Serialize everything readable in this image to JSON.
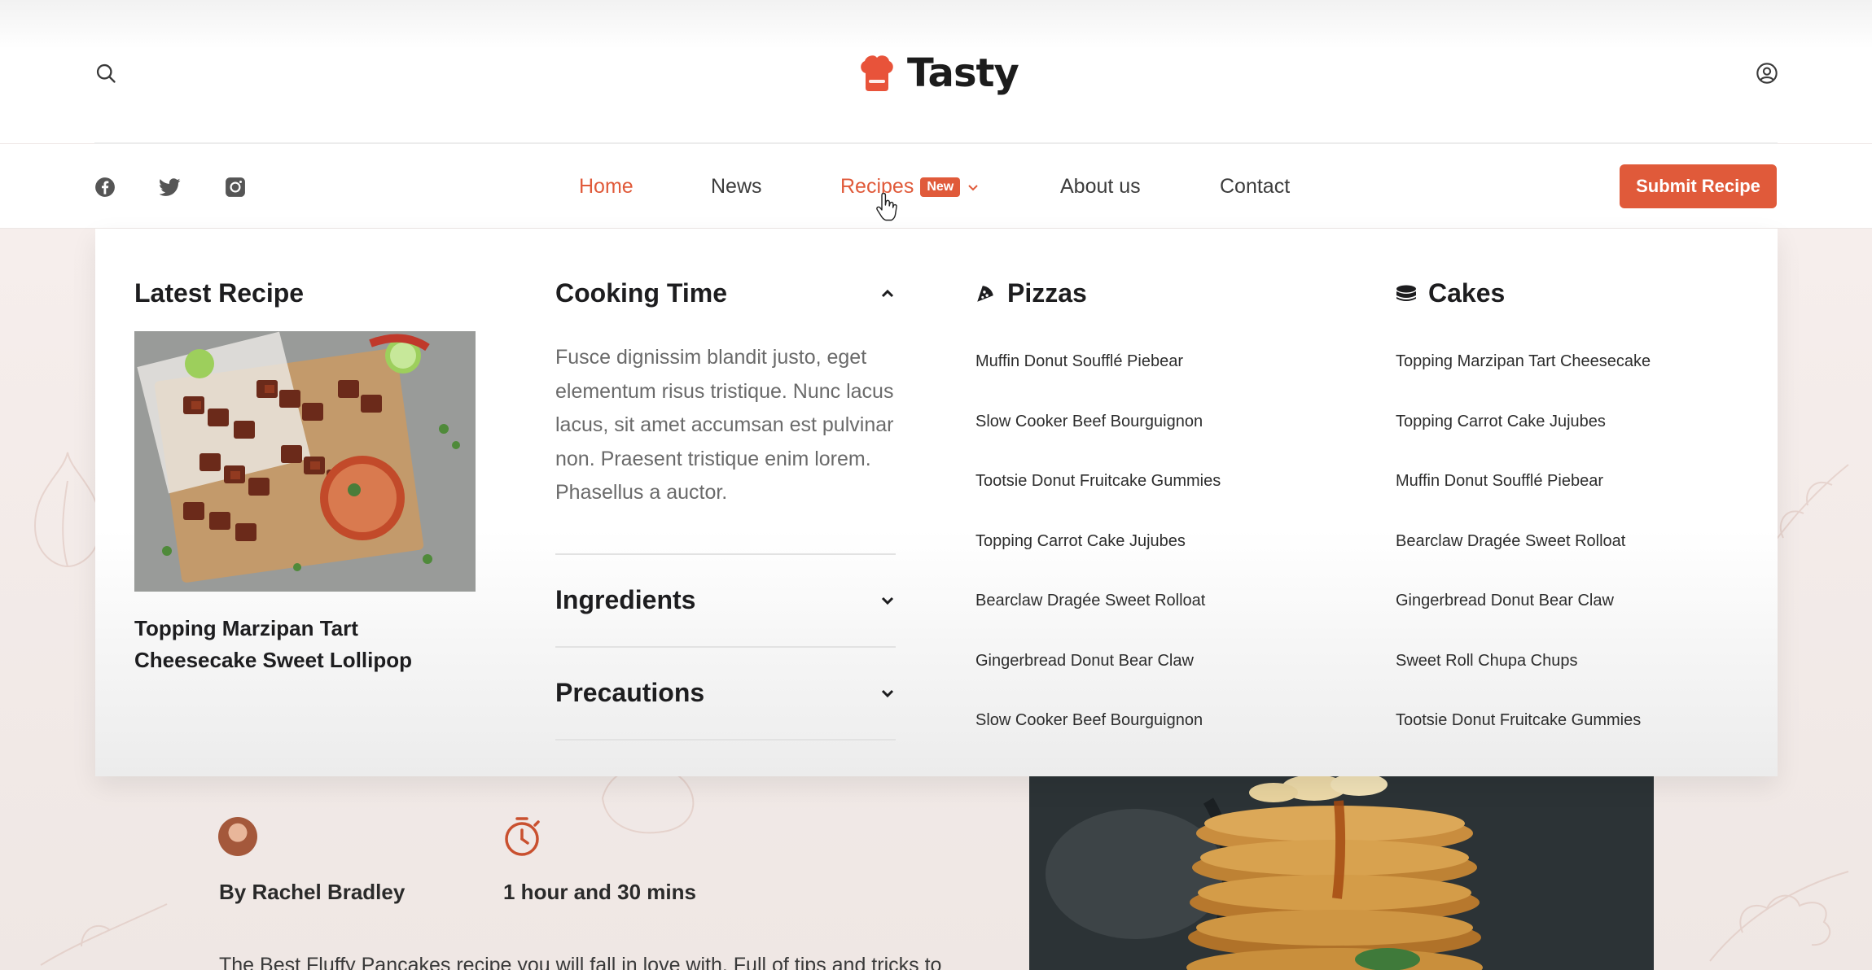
{
  "brand": {
    "name": "Tasty",
    "accent": "#e05a3a"
  },
  "header": {
    "search_icon": "search-icon",
    "user_icon": "user-circle-icon"
  },
  "social": [
    "facebook-icon",
    "twitter-icon",
    "instagram-icon"
  ],
  "nav": {
    "items": [
      {
        "label": "Home",
        "active": true
      },
      {
        "label": "News"
      },
      {
        "label": "Recipes",
        "badge": "New",
        "has_dropdown": true
      },
      {
        "label": "About us"
      },
      {
        "label": "Contact"
      }
    ],
    "cta": "Submit Recipe"
  },
  "mega_menu": {
    "latest": {
      "title": "Latest Recipe",
      "caption": "Topping Marzipan Tart Cheesecake Sweet Lollipop"
    },
    "accordion": [
      {
        "title": "Cooking Time",
        "expanded": true,
        "body": "Fusce dignissim blandit justo, eget elementum risus tristique. Nunc lacus lacus, sit amet accumsan est pulvinar non. Praesent tristique enim lorem. Phasellus a auctor."
      },
      {
        "title": "Ingredients",
        "expanded": false
      },
      {
        "title": "Precautions",
        "expanded": false
      }
    ],
    "pizzas": {
      "title": "Pizzas",
      "items": [
        "Muffin Donut Soufflé Piebear",
        "Slow Cooker Beef Bourguignon",
        "Tootsie Donut Fruitcake Gummies",
        "Topping Carrot Cake Jujubes",
        "Bearclaw Dragée Sweet Rolloat",
        "Gingerbread Donut Bear Claw",
        "Slow Cooker Beef Bourguignon"
      ]
    },
    "cakes": {
      "title": "Cakes",
      "items": [
        "Topping Marzipan Tart Cheesecake",
        "Topping Carrot Cake Jujubes",
        "Muffin Donut Soufflé Piebear",
        "Bearclaw Dragée Sweet Rolloat",
        "Gingerbread Donut Bear Claw",
        "Sweet Roll Chupa Chups",
        "Tootsie Donut Fruitcake Gummies"
      ]
    }
  },
  "page": {
    "author": "By Rachel Bradley",
    "time": "1 hour and 30 mins",
    "intro": "The Best Fluffy Pancakes recipe you will fall in love with. Full of tips and tricks to"
  }
}
